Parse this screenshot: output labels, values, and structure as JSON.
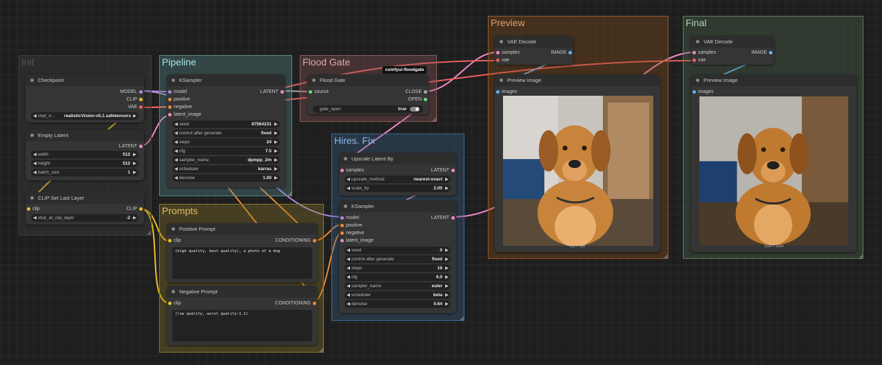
{
  "groups": {
    "init": "Init",
    "pipeline": "Pipeline",
    "flood_gate": "Flood Gate",
    "prompts": "Prompts",
    "hires": "Hires. Fix",
    "preview": "Preview",
    "final": "Final"
  },
  "badge": "comfyui-floodgate",
  "checkpoint": {
    "title": "Checkpoint",
    "outputs": [
      "MODEL",
      "CLIP",
      "VAE"
    ],
    "ckpt_label": "ckpt_n...",
    "ckpt_value": "realisticVision-v5.1.safetensors"
  },
  "empty_latent": {
    "title": "Empty Latent",
    "output": "LATENT",
    "width_label": "width",
    "width_value": "512",
    "height_label": "height",
    "height_value": "512",
    "batch_label": "batch_size",
    "batch_value": "1"
  },
  "clip_set": {
    "title": "CLIP Set Last Layer",
    "input": "clip",
    "output": "CLIP",
    "stop_label": "stop_at_clip_layer",
    "stop_value": "-2"
  },
  "ksampler1": {
    "title": "KSampler",
    "inputs": [
      "model",
      "positive",
      "negative",
      "latent_image"
    ],
    "output": "LATENT",
    "widgets": [
      {
        "label": "seed",
        "value": "87564231"
      },
      {
        "label": "control after generate",
        "value": "fixed"
      },
      {
        "label": "steps",
        "value": "24"
      },
      {
        "label": "cfg",
        "value": "7.5"
      },
      {
        "label": "sampler_name",
        "value": "dpmpp_2m"
      },
      {
        "label": "scheduler",
        "value": "karras"
      },
      {
        "label": "denoise",
        "value": "1.00"
      }
    ]
  },
  "flood_node": {
    "title": "Flood Gate",
    "input": "source",
    "outputs": [
      "CLOSE",
      "OPEN"
    ],
    "gate_label": "gate_open",
    "gate_value": "true"
  },
  "positive": {
    "title": "Positive Prompt",
    "input": "clip",
    "output": "CONDITIONING",
    "text": "(high quality, best quality), a photo of a dog"
  },
  "negative": {
    "title": "Negative Prompt",
    "input": "clip",
    "output": "CONDITIONING",
    "text": "(low quality, worst quality:1.2)"
  },
  "upscale": {
    "title": "Upscale Latent By",
    "input": "samples",
    "output": "LATENT",
    "method_label": "upscale_method",
    "method_value": "nearest-exact",
    "scale_label": "scale_by",
    "scale_value": "2.00"
  },
  "ksampler2": {
    "title": "KSampler",
    "inputs": [
      "model",
      "positive",
      "negative",
      "latent_image"
    ],
    "output": "LATENT",
    "widgets": [
      {
        "label": "seed",
        "value": "0"
      },
      {
        "label": "control after generate",
        "value": "fixed"
      },
      {
        "label": "steps",
        "value": "16"
      },
      {
        "label": "cfg",
        "value": "6.0"
      },
      {
        "label": "sampler_name",
        "value": "euler"
      },
      {
        "label": "scheduler",
        "value": "beta"
      },
      {
        "label": "denoise",
        "value": "0.64"
      }
    ]
  },
  "vae_preview": {
    "title": "VAE Decode",
    "inputs": [
      "samples",
      "vae"
    ],
    "output": "IMAGE"
  },
  "preview_image": {
    "title": "Preview Image",
    "input": "images",
    "size": "512 × 512"
  },
  "vae_final": {
    "title": "VAE Decode",
    "inputs": [
      "samples",
      "vae"
    ],
    "output": "IMAGE"
  },
  "final_image": {
    "title": "Preview Image",
    "input": "images",
    "size": "1024 × 1024"
  },
  "colors": {
    "model": "#b38ae0",
    "clip": "#f0c020",
    "vae": "#f06060",
    "conditioning": "#f08a30",
    "latent": "#f08ac8",
    "image": "#64b5f6"
  }
}
